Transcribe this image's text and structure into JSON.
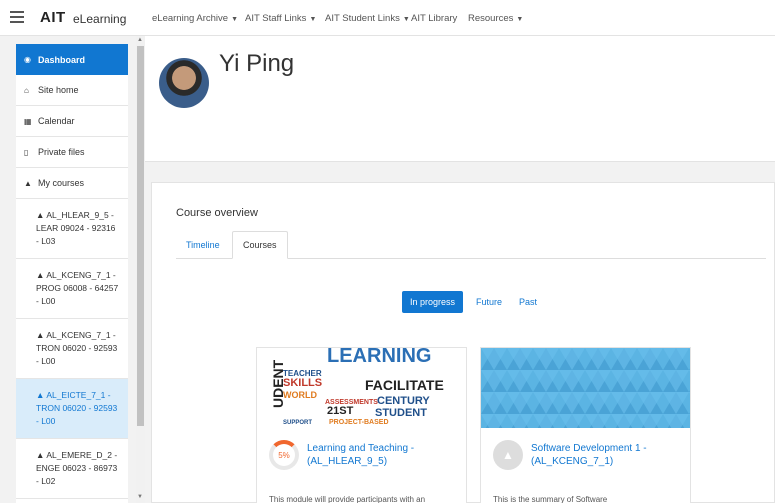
{
  "navbar": {
    "logo": "AIT",
    "site_name": "eLearning",
    "menu": [
      {
        "label": "eLearning Archive"
      },
      {
        "label": "AIT Staff Links"
      },
      {
        "label": "AIT Student Links"
      },
      {
        "label": "AIT Library"
      },
      {
        "label": "Resources"
      }
    ]
  },
  "drawer": {
    "items": [
      {
        "label": "Dashboard",
        "icon": "dashboard-icon"
      },
      {
        "label": "Site home",
        "icon": "home-icon"
      },
      {
        "label": "Calendar",
        "icon": "calendar-icon"
      },
      {
        "label": "Private files",
        "icon": "file-icon"
      },
      {
        "label": "My courses",
        "icon": "graduation-cap-icon"
      }
    ],
    "courses": [
      {
        "label": "AL_HLEAR_9_5 - LEAR 09024 - 92316 - L03"
      },
      {
        "label": "AL_KCENG_7_1 - PROG 06008 - 64257 - L00"
      },
      {
        "label": "AL_KCENG_7_1 - TRON 06020 - 92593 - L00"
      },
      {
        "label": "AL_EICTE_7_1 - TRON 06020 - 92593 - L00"
      },
      {
        "label": "AL_EMERE_D_2 - ENGE 06023 - 86973 - L02"
      }
    ]
  },
  "header": {
    "username": "Yi Ping"
  },
  "overview": {
    "title": "Course overview",
    "tabs": [
      {
        "label": "Timeline"
      },
      {
        "label": "Courses"
      }
    ],
    "filters": [
      {
        "label": "In progress"
      },
      {
        "label": "Future"
      },
      {
        "label": "Past"
      }
    ],
    "cards": [
      {
        "name": "Learning and Teaching - (AL_HLEAR_9_5)",
        "progress": "5%",
        "summary": "This module will provide participants with an",
        "image_words": [
          "LEARNING",
          "TEACHER",
          "SKILLS",
          "FACILITATE",
          "WORLD",
          "CENTURY",
          "21ST",
          "STUDENT",
          "ASSESSMENTS",
          "PROJECT-BASED",
          "SUPPORT",
          "UDENT"
        ]
      },
      {
        "name": "Software Development 1 - (AL_KCENG_7_1)",
        "summary": "This is the summary of Software"
      }
    ]
  },
  "colors": {
    "accent": "#1177d1",
    "progress": "#f0672e",
    "pattern": "#5bb4e3"
  }
}
